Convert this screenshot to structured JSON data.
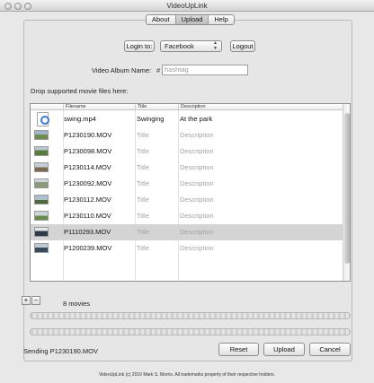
{
  "window": {
    "title": "VideoUpLink"
  },
  "tabs": [
    {
      "label": "About",
      "active": false
    },
    {
      "label": "Upload",
      "active": true
    },
    {
      "label": "Help",
      "active": false
    }
  ],
  "login": {
    "login_label": "Login to:",
    "service_selected": "Facebook",
    "logout_label": "Logout"
  },
  "album": {
    "label": "Video Album Name:",
    "hash_symbol": "#",
    "placeholder": "hashtag"
  },
  "drop_label": "Drop supported movie files here:",
  "table": {
    "columns": [
      "Filename",
      "Title",
      "Description"
    ],
    "rows": [
      {
        "filename": "swing.mp4",
        "title": "Swinging",
        "description": "At the park",
        "thumbnail": "document-icon",
        "selected": false
      },
      {
        "filename": "P1230190.MOV",
        "title": "Title",
        "description": "Description",
        "thumbnail": "video-thumbnail",
        "selected": false
      },
      {
        "filename": "P1230098.MOV",
        "title": "Title",
        "description": "Description",
        "thumbnail": "video-thumbnail",
        "selected": false
      },
      {
        "filename": "P1230114.MOV",
        "title": "Title",
        "description": "Description",
        "thumbnail": "video-thumbnail",
        "selected": false
      },
      {
        "filename": "P1230092.MOV",
        "title": "Title",
        "description": "Description",
        "thumbnail": "video-thumbnail",
        "selected": false
      },
      {
        "filename": "P1230112.MOV",
        "title": "Title",
        "description": "Description",
        "thumbnail": "video-thumbnail",
        "selected": false
      },
      {
        "filename": "P1230110.MOV",
        "title": "Title",
        "description": "Description",
        "thumbnail": "video-thumbnail",
        "selected": false
      },
      {
        "filename": "P1110293.MOV",
        "title": "Title",
        "description": "Description",
        "thumbnail": "video-thumbnail",
        "selected": true
      },
      {
        "filename": "P1200239.MOV",
        "title": "Title",
        "description": "Description",
        "thumbnail": "video-thumbnail",
        "selected": false
      }
    ]
  },
  "controls": {
    "add_label": "+",
    "remove_label": "–"
  },
  "movie_count": "8 movies",
  "status_text": "Sending P1230190.MOV",
  "buttons": {
    "reset": "Reset",
    "upload": "Upload",
    "cancel": "Cancel"
  },
  "footer": "VideoUpLink (c) 2010 Mark S. Morris. All trademarks property of their respective holders.",
  "colors": {
    "selected_row": "#d4d4d4",
    "placeholder_text": "#a2a2a2",
    "accent_icon": "#3b7bd6"
  }
}
